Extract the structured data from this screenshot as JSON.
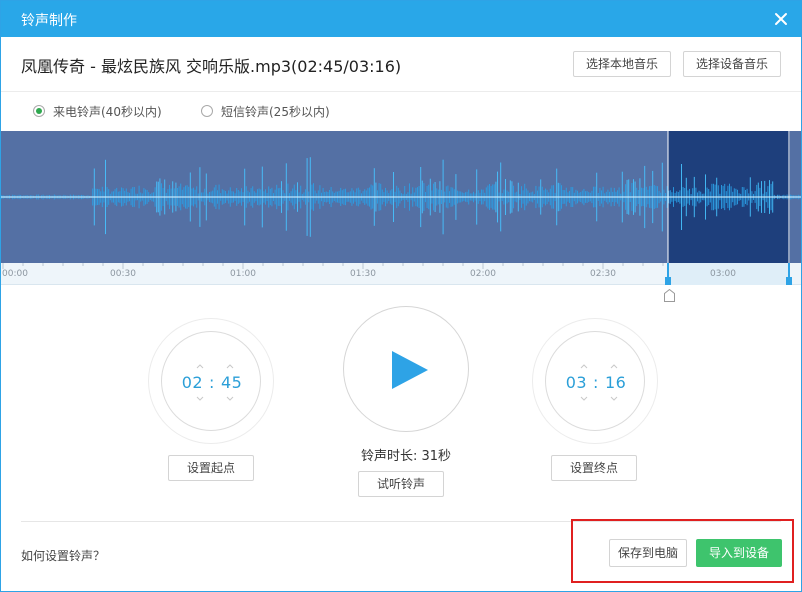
{
  "window": {
    "title": "铃声制作",
    "close_icon": "close-icon"
  },
  "file": {
    "name": "凤凰传奇 - 最炫民族风 交响乐版.mp3(02:45/03:16)"
  },
  "toolbar": {
    "local_music_label": "选择本地音乐",
    "device_music_label": "选择设备音乐"
  },
  "ringtone_type": {
    "call_label": "来电铃声(40秒以内)",
    "sms_label": "短信铃声(25秒以内)",
    "selected": "call"
  },
  "timeline": {
    "ticks": [
      "00:00",
      "00:30",
      "01:00",
      "01:30",
      "02:00",
      "02:30",
      "03:00"
    ],
    "total_seconds": 196,
    "selection_start_seconds": 165,
    "selection_end_seconds": 196
  },
  "start_time": {
    "minutes": "02",
    "seconds": "45"
  },
  "end_time": {
    "minutes": "03",
    "seconds": "16"
  },
  "player": {
    "play_icon": "play-icon",
    "duration_label": "铃声时长: 31秒"
  },
  "actions": {
    "set_start_label": "设置起点",
    "set_end_label": "设置终点",
    "listen_label": "试听铃声",
    "save_pc_label": "保存到电脑",
    "import_device_label": "导入到设备",
    "help_label": "如何设置铃声？"
  },
  "colors": {
    "title_bar": "#29a7e8",
    "waveform_bg": "#5470a4",
    "selection_bg": "#1e3f7c",
    "wave": "#2fb6ff",
    "time_text": "#2b9fd8",
    "play": "#2ea3e6",
    "import_button": "#3ec46d",
    "highlight": "#e02020"
  }
}
